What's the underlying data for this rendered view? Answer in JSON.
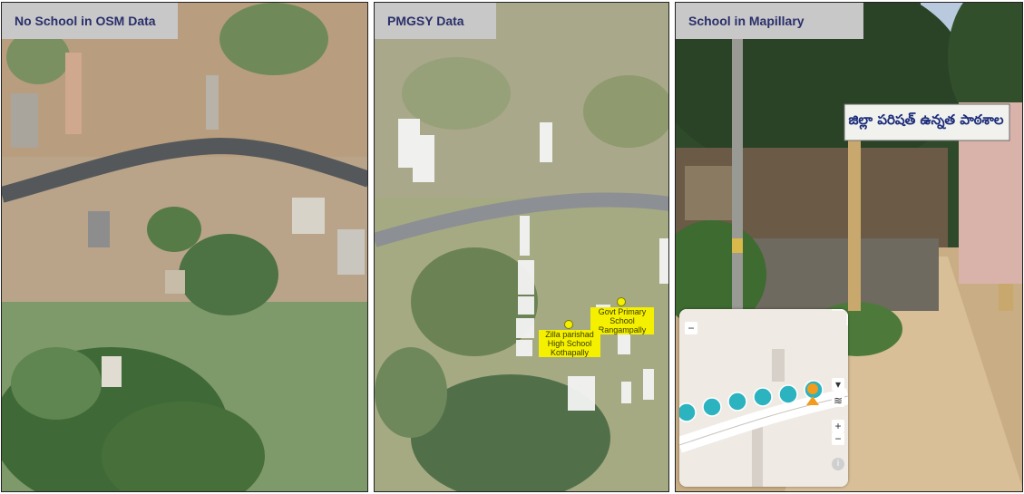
{
  "panels": [
    {
      "title": "No School in OSM Data"
    },
    {
      "title": "PMGSY Data"
    },
    {
      "title": "School in Mapillary"
    }
  ],
  "pmgsy": {
    "poi_1": "Govt Primary School Rangampally",
    "poi_2": "Zilla parishad High School Kothapally"
  },
  "mapillary": {
    "sign_text": "జిల్లా పరిషత్ ఉన్నత పాఠశాల",
    "minimap": {
      "minus": "−",
      "plus": "+",
      "info": "i"
    }
  }
}
